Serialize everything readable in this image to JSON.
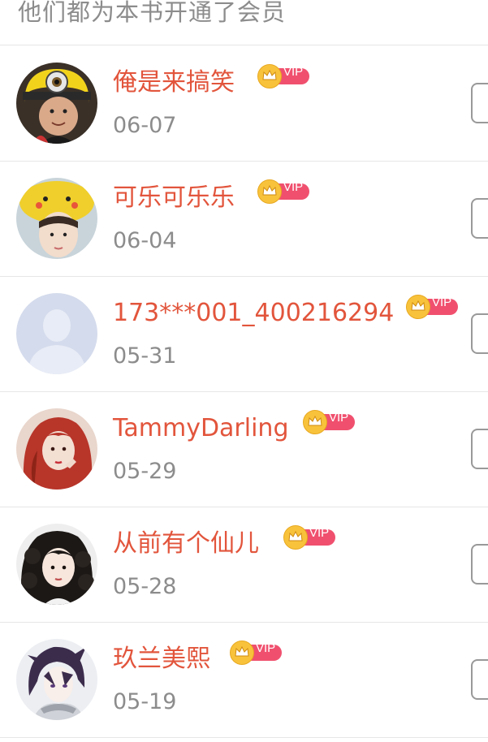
{
  "header": {
    "title": "他们都为本书开通了会员"
  },
  "vip_label": "VIP",
  "colors": {
    "name": "#e2553c",
    "date": "#8c8c8c",
    "vip_pill": "#f0506e",
    "vip_crown": "#f8c33b"
  },
  "members": [
    {
      "name": "俺是来搞笑",
      "date": "06-07",
      "avatar_icon": "avatar-minion-hat-icon"
    },
    {
      "name": "可乐可乐乐",
      "date": "06-04",
      "avatar_icon": "avatar-pikachu-hat-icon"
    },
    {
      "name": "173***001_400216294",
      "date": "05-31",
      "avatar_icon": "avatar-default-silhouette-icon"
    },
    {
      "name": "TammyDarling",
      "date": "05-29",
      "avatar_icon": "avatar-red-hair-icon"
    },
    {
      "name": "从前有个仙儿",
      "date": "05-28",
      "avatar_icon": "avatar-curly-hair-icon"
    },
    {
      "name": "玖兰美熙",
      "date": "05-19",
      "avatar_icon": "avatar-anime-icon"
    }
  ]
}
